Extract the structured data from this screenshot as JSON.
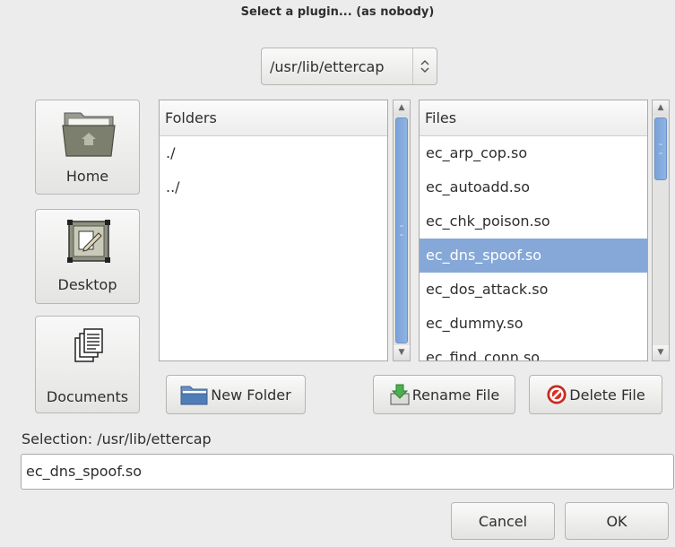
{
  "window": {
    "title": "Select a plugin... (as nobody)"
  },
  "path_combo": {
    "value": "/usr/lib/ettercap",
    "icon": "up-down-arrows-icon"
  },
  "places": [
    {
      "label": "Home",
      "icon": "home-folder-icon"
    },
    {
      "label": "Desktop",
      "icon": "desktop-icon"
    },
    {
      "label": "Documents",
      "icon": "documents-icon"
    }
  ],
  "folders": {
    "header": "Folders",
    "items": [
      "./",
      "../"
    ]
  },
  "files": {
    "header": "Files",
    "items": [
      "ec_arp_cop.so",
      "ec_autoadd.so",
      "ec_chk_poison.so",
      "ec_dns_spoof.so",
      "ec_dos_attack.so",
      "ec_dummy.so",
      "ec_find_conn.so"
    ],
    "selected": "ec_dns_spoof.so"
  },
  "buttons": {
    "new_folder": "New Folder",
    "rename_file": "Rename File",
    "delete_file": "Delete File",
    "cancel": "Cancel",
    "ok": "OK"
  },
  "selection": {
    "label": "Selection: /usr/lib/ettercap",
    "value": "ec_dns_spoof.so"
  },
  "colors": {
    "selection_highlight": "#86a8d8",
    "scroll_thumb": "#7aa3da"
  }
}
